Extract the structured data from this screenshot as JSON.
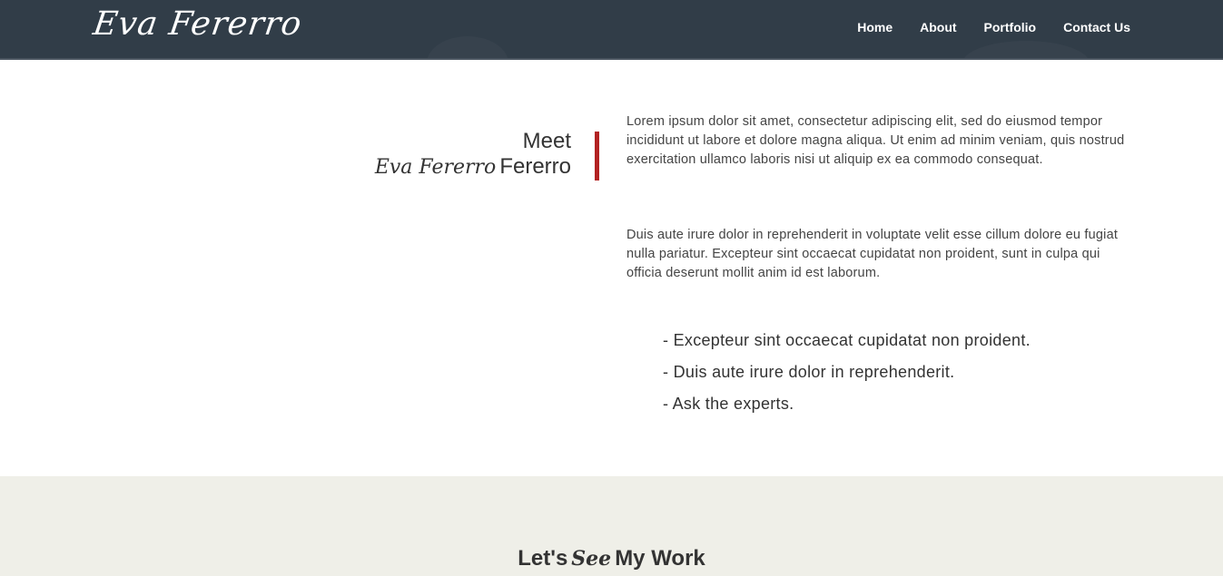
{
  "header": {
    "logo": "Eva Fererro",
    "nav": [
      "Home",
      "About",
      "Portfolio",
      "Contact Us"
    ]
  },
  "about": {
    "heading": {
      "meet": "Meet",
      "name_script": "Eva Fererro",
      "name_plain": "Fererro"
    },
    "paragraphs": [
      "Lorem ipsum dolor sit amet, consectetur adipiscing elit, sed do eiusmod tempor incididunt ut labore et dolore magna aliqua. Ut enim ad minim veniam, quis nostrud exercitation ullamco laboris nisi ut aliquip ex ea commodo consequat.",
      "Duis aute irure dolor in reprehenderit in voluptate velit esse cillum dolore eu fugiat nulla pariatur. Excepteur sint occaecat cupidatat non proident, sunt in culpa qui officia deserunt mollit anim id est laborum."
    ],
    "bullets": [
      "- Excepteur sint occaecat cupidatat non proident.",
      "- Duis aute irure dolor in reprehenderit.",
      "- Ask the experts."
    ]
  },
  "work": {
    "title_before": "Let's",
    "title_script": "See",
    "title_after": "My Work"
  },
  "colors": {
    "header_bg": "#313d48",
    "accent_red": "#b22222",
    "work_bg": "#efefe8",
    "text": "#333333"
  }
}
